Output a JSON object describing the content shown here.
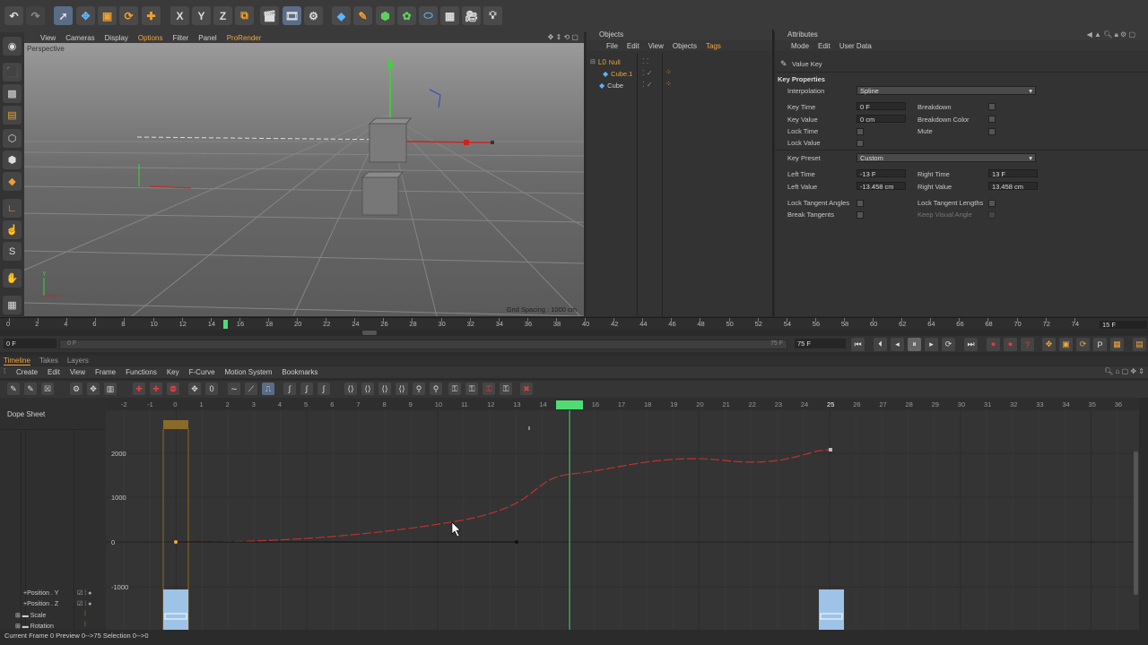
{
  "viewport": {
    "label": "Perspective",
    "menu": [
      "View",
      "Cameras",
      "Display",
      "Options",
      "Filter",
      "Panel",
      "ProRender"
    ],
    "active_menu": "Options",
    "grid_spacing": "Grid Spacing : 1000 cm"
  },
  "objects": {
    "title": "Objects",
    "menu": [
      "File",
      "Edit",
      "View",
      "Objects",
      "Tags"
    ],
    "items": [
      {
        "name": "Null",
        "color": "#e8a33a",
        "level": 0
      },
      {
        "name": "Cube.1",
        "color": "#e8a33a",
        "level": 1
      },
      {
        "name": "Cube",
        "color": "#cfcfcf",
        "level": 0
      }
    ]
  },
  "attributes": {
    "title": "Attributes",
    "menu": [
      "Mode",
      "Edit",
      "User Data"
    ],
    "object_label": "Value Key",
    "section": "Key Properties",
    "interpolation_label": "Interpolation",
    "interpolation_value": "Spline",
    "key_time_label": "Key Time",
    "key_time_value": "0 F",
    "key_value_label": "Key Value",
    "key_value_value": "0 cm",
    "lock_time_label": "Lock Time",
    "lock_value_label": "Lock Value",
    "breakdown_label": "Breakdown",
    "breakdown_color_label": "Breakdown Color",
    "mute_label": "Mute",
    "key_preset_label": "Key Preset",
    "key_preset_value": "Custom",
    "left_time_label": "Left  Time",
    "left_time_value": "-13 F",
    "left_value_label": "Left  Value",
    "left_value_value": "-13.458 cm",
    "right_time_label": "Right Time",
    "right_time_value": "13 F",
    "right_value_label": "Right Value",
    "right_value_value": "13.458 cm",
    "lock_tangent_angles_label": "Lock Tangent Angles",
    "lock_tangent_lengths_label": "Lock Tangent Lengths",
    "break_tangents_label": "Break Tangents",
    "keep_visual_angle_label": "Keep Visual Angle"
  },
  "timeline_ruler": {
    "ticks": [
      "0",
      "2",
      "4",
      "6",
      "8",
      "10",
      "12",
      "14",
      "16",
      "18",
      "20",
      "22",
      "24",
      "26",
      "28",
      "30",
      "32",
      "34",
      "36",
      "38",
      "40",
      "42",
      "44",
      "46",
      "48",
      "50",
      "52",
      "54",
      "56",
      "58",
      "60",
      "62",
      "64",
      "66",
      "68",
      "70",
      "72",
      "74"
    ],
    "end_label": "15 F"
  },
  "transport": {
    "current_frame": "0 F",
    "range_start": "0 F",
    "range_end": "75 F",
    "end_frame": "75 F"
  },
  "timeline": {
    "tabs": [
      "Timeline",
      "Takes",
      "Layers"
    ],
    "active_tab": "Timeline",
    "menu": [
      "Create",
      "Edit",
      "View",
      "Frame",
      "Functions",
      "Key",
      "F-Curve",
      "Motion System",
      "Bookmarks"
    ],
    "mode_label": "Dope Sheet",
    "frame_ticks": [
      "-2",
      "-1",
      "0",
      "1",
      "2",
      "3",
      "4",
      "5",
      "6",
      "7",
      "8",
      "9",
      "10",
      "11",
      "12",
      "13",
      "14",
      "15",
      "16",
      "17",
      "18",
      "19",
      "20",
      "21",
      "22",
      "23",
      "24",
      "25",
      "26",
      "27",
      "28",
      "29",
      "30",
      "31",
      "32",
      "33",
      "34",
      "35",
      "36"
    ],
    "current_frame": "15",
    "highlight_frame": "25",
    "value_labels": [
      "2000",
      "1000",
      "0",
      "-1000"
    ],
    "tracks": [
      "Position . Y",
      "Position . Z",
      "Scale",
      "Rotation"
    ]
  },
  "status": {
    "text": "Current Frame  0  Preview  0-->75   Selection  0-->0"
  },
  "colors": {
    "accent": "#f3a63a",
    "playhead": "#4fdc73",
    "curve": "#c0312e",
    "key_block": "#9dc3e6"
  }
}
